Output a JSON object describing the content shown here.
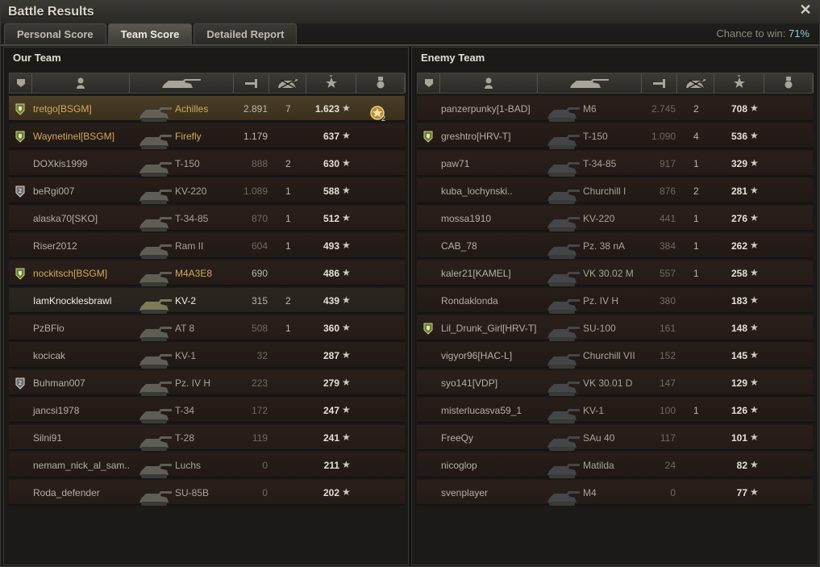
{
  "window": {
    "title": "Battle Results",
    "close_label": "✕"
  },
  "tabs": [
    {
      "label": "Personal Score",
      "active": false
    },
    {
      "label": "Team Score",
      "active": true
    },
    {
      "label": "Detailed Report",
      "active": false
    }
  ],
  "win_chance": {
    "label": "Chance to win: ",
    "value": "71%"
  },
  "columns": [
    "squad",
    "player",
    "vehicle",
    "damage",
    "kills",
    "experience",
    "medals"
  ],
  "our_team": {
    "title": "Our Team",
    "players": [
      {
        "name": "tretgo[BSGM]",
        "tank": "Achilles",
        "damage": "2.891",
        "kills": "7",
        "xp": "1.623",
        "badge": "squad",
        "style": "self",
        "medal": "2"
      },
      {
        "name": "Waynetinel[BSGM]",
        "tank": "Firefly",
        "damage": "1.179",
        "kills": "",
        "xp": "637",
        "badge": "squad",
        "style": "clan"
      },
      {
        "name": "DOXkis1999",
        "tank": "T-150",
        "damage": "888",
        "kills": "2",
        "xp": "630",
        "badge": "",
        "style": ""
      },
      {
        "name": "beRgi007",
        "tank": "KV-220",
        "damage": "1.089",
        "kills": "1",
        "xp": "588",
        "badge": "squad2",
        "style": ""
      },
      {
        "name": "alaska70[SKO]",
        "tank": "T-34-85",
        "damage": "870",
        "kills": "1",
        "xp": "512",
        "badge": "",
        "style": ""
      },
      {
        "name": "Riser2012",
        "tank": "Ram II",
        "damage": "604",
        "kills": "1",
        "xp": "493",
        "badge": "",
        "style": ""
      },
      {
        "name": "nockitsch[BSGM]",
        "tank": "M4A3E8",
        "damage": "690",
        "kills": "",
        "xp": "486",
        "badge": "squad",
        "style": "clan"
      },
      {
        "name": "IamKnocklesbrawl",
        "tank": "KV-2",
        "damage": "315",
        "kills": "2",
        "xp": "439",
        "badge": "",
        "style": "me"
      },
      {
        "name": "PzBFlo",
        "tank": "AT 8",
        "damage": "508",
        "kills": "1",
        "xp": "360",
        "badge": "",
        "style": ""
      },
      {
        "name": "kocicak",
        "tank": "KV-1",
        "damage": "32",
        "kills": "",
        "xp": "287",
        "badge": "",
        "style": ""
      },
      {
        "name": "Buhman007",
        "tank": "Pz. IV H",
        "damage": "223",
        "kills": "",
        "xp": "279",
        "badge": "squad2",
        "style": ""
      },
      {
        "name": "jancsi1978",
        "tank": "T-34",
        "damage": "172",
        "kills": "",
        "xp": "247",
        "badge": "",
        "style": ""
      },
      {
        "name": "Silni91",
        "tank": "T-28",
        "damage": "119",
        "kills": "",
        "xp": "241",
        "badge": "",
        "style": ""
      },
      {
        "name": "nemam_nick_al_sam..",
        "tank": "Luchs",
        "damage": "0",
        "kills": "",
        "xp": "211",
        "badge": "",
        "style": ""
      },
      {
        "name": "Roda_defender",
        "tank": "SU-85B",
        "damage": "0",
        "kills": "",
        "xp": "202",
        "badge": "",
        "style": ""
      }
    ]
  },
  "enemy_team": {
    "title": "Enemy Team",
    "players": [
      {
        "name": "panzerpunky[1-BAD]",
        "tank": "M6",
        "damage": "2.745",
        "kills": "2",
        "xp": "708",
        "badge": ""
      },
      {
        "name": "greshtro[HRV-T]",
        "tank": "T-150",
        "damage": "1.090",
        "kills": "4",
        "xp": "536",
        "badge": "squad"
      },
      {
        "name": "paw71",
        "tank": "T-34-85",
        "damage": "917",
        "kills": "1",
        "xp": "329",
        "badge": ""
      },
      {
        "name": "kuba_lochynski..",
        "tank": "Churchill I",
        "damage": "876",
        "kills": "2",
        "xp": "281",
        "badge": ""
      },
      {
        "name": "mossa1910",
        "tank": "KV-220",
        "damage": "441",
        "kills": "1",
        "xp": "276",
        "badge": ""
      },
      {
        "name": "CAB_78",
        "tank": "Pz. 38 nA",
        "damage": "384",
        "kills": "1",
        "xp": "262",
        "badge": ""
      },
      {
        "name": "kaler21[KAMEL]",
        "tank": "VK 30.02 M",
        "damage": "557",
        "kills": "1",
        "xp": "258",
        "badge": ""
      },
      {
        "name": "Rondaklonda",
        "tank": "Pz. IV H",
        "damage": "380",
        "kills": "",
        "xp": "183",
        "badge": ""
      },
      {
        "name": "Lil_Drunk_Girl[HRV-T]",
        "tank": "SU-100",
        "damage": "161",
        "kills": "",
        "xp": "148",
        "badge": "squad"
      },
      {
        "name": "vigyor96[HAC-L]",
        "tank": "Churchill VII",
        "damage": "152",
        "kills": "",
        "xp": "145",
        "badge": ""
      },
      {
        "name": "syo141[VDP]",
        "tank": "VK 30.01 D",
        "damage": "147",
        "kills": "",
        "xp": "129",
        "badge": ""
      },
      {
        "name": "misterlucasva59_1",
        "tank": "KV-1",
        "damage": "100",
        "kills": "1",
        "xp": "126",
        "badge": ""
      },
      {
        "name": "FreeQy",
        "tank": "SAu 40",
        "damage": "117",
        "kills": "",
        "xp": "101",
        "badge": ""
      },
      {
        "name": "nicoglop",
        "tank": "Matilda",
        "damage": "24",
        "kills": "",
        "xp": "82",
        "badge": ""
      },
      {
        "name": "svenplayer",
        "tank": "M4",
        "damage": "0",
        "kills": "",
        "xp": "77",
        "badge": ""
      }
    ]
  }
}
